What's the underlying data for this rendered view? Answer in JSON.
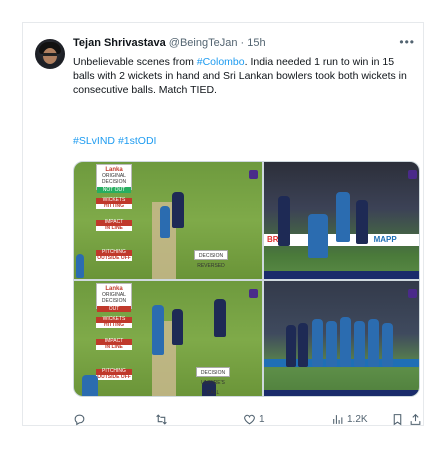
{
  "tweet": {
    "author_name": "Tejan Shrivastava",
    "handle": "@BeingTeJan",
    "separator": "·",
    "time": "15h",
    "more_icon": "ellipsis-icon",
    "text_before_link": "Unbelievable scenes from ",
    "link": "#Colombo",
    "text_after_link": ". India needed 1 run to win in 15 balls with 2 wickets in hand and Sri Lankan bowlers took both wickets in consecutive balls. Match TIED.",
    "hashtag_1": "#SLvIND",
    "hashtag_2": "#1stODI"
  },
  "media": {
    "panel_top": {
      "logo": "Lanka",
      "original_decision": "ORIGINAL DECISION",
      "original_value": "NOT OUT",
      "wickets_title": "WICKETS",
      "wickets_value": "HITTING",
      "impact_title": "IMPACT",
      "impact_value": "IN LINE",
      "pitching_title": "PITCHING",
      "pitching_value": "OUTSIDE OFF",
      "decision_tag": "DECISION REVERSED"
    },
    "panel_bottom": {
      "logo": "Lanka",
      "original_decision": "ORIGINAL DECISION",
      "original_value": "OUT",
      "wickets_title": "WICKETS",
      "wickets_value": "HITTING",
      "impact_title": "IMPACT",
      "impact_value": "IN LINE",
      "pitching_title": "PITCHING",
      "pitching_value": "OUTSIDE OFF",
      "decision_tag": "DECISION UMPIRE'S CALL"
    },
    "ad_text": "MAPP",
    "ad_text_2": "BR"
  },
  "actions": {
    "reply_count": "",
    "retweet_count": "",
    "like_count": "1",
    "views_count": "1.2K"
  },
  "colors": {
    "link": "#1d9bf0",
    "muted": "#536471",
    "text": "#0f1419"
  }
}
